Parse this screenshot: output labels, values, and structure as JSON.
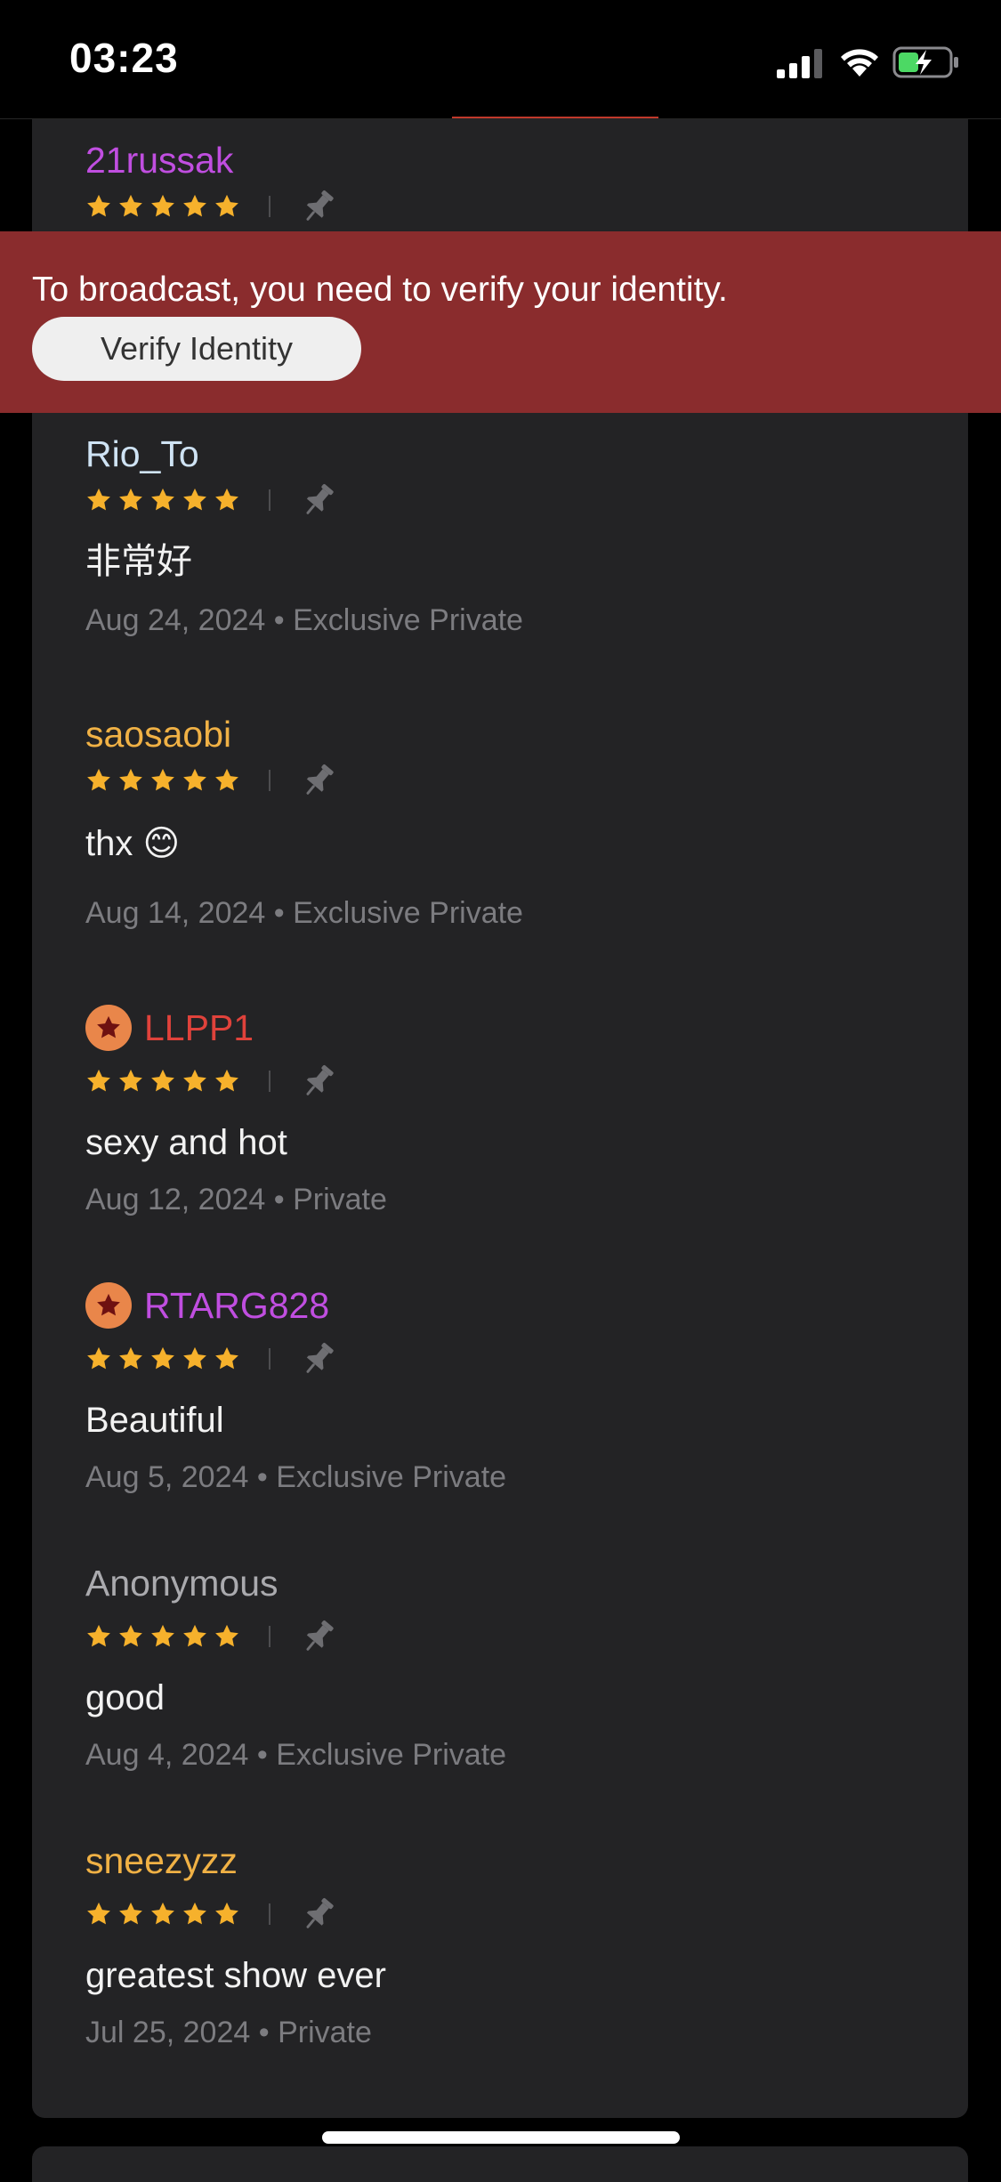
{
  "status_bar": {
    "time": "03:23",
    "signal_icon": "cellular-signal-icon",
    "wifi_icon": "wifi-icon",
    "battery_icon": "battery-charging-icon"
  },
  "colors": {
    "panel_background": "#232325",
    "banner_background": "#8a2c2d",
    "star_color": "#f6b12c",
    "meta_text": "#7c7c80",
    "badge_orange": "#e9864a"
  },
  "banner": {
    "message": "To broadcast, you need to verify your identity.",
    "button_label": "Verify Identity"
  },
  "reviews": [
    {
      "username": "21russak",
      "username_color": "#c04ee0",
      "rating": 5,
      "text": "",
      "date": "",
      "type": "",
      "has_badge": false
    },
    {
      "username": "Rio_To",
      "username_color": "#cfe3f4",
      "rating": 5,
      "text": "非常好",
      "date": "Aug 24, 2024",
      "type": "Exclusive Private",
      "has_badge": false
    },
    {
      "username": "saosaobi",
      "username_color": "#f0b145",
      "rating": 5,
      "text": "thx 😊",
      "date": "Aug 14, 2024",
      "type": "Exclusive Private",
      "has_badge": false
    },
    {
      "username": "LLPP1",
      "username_color": "#e0423b",
      "rating": 5,
      "text": "sexy and hot",
      "date": "Aug 12, 2024",
      "type": "Private",
      "has_badge": true,
      "badge_icon": "star-badge-icon"
    },
    {
      "username": "RTARG828",
      "username_color": "#c04ee0",
      "rating": 5,
      "text": "Beautiful",
      "date": "Aug 5, 2024",
      "type": "Exclusive Private",
      "has_badge": true,
      "badge_icon": "star-badge-icon"
    },
    {
      "username": "Anonymous",
      "username_color": "#aaaaae",
      "rating": 5,
      "text": "good",
      "date": "Aug 4, 2024",
      "type": "Exclusive Private",
      "has_badge": false
    },
    {
      "username": "sneezyzz",
      "username_color": "#f0b145",
      "rating": 5,
      "text": "greatest show ever",
      "date": "Jul 25, 2024",
      "type": "Private",
      "has_badge": false
    }
  ],
  "meta_separator": " • ",
  "pin_icon": "pin-icon"
}
